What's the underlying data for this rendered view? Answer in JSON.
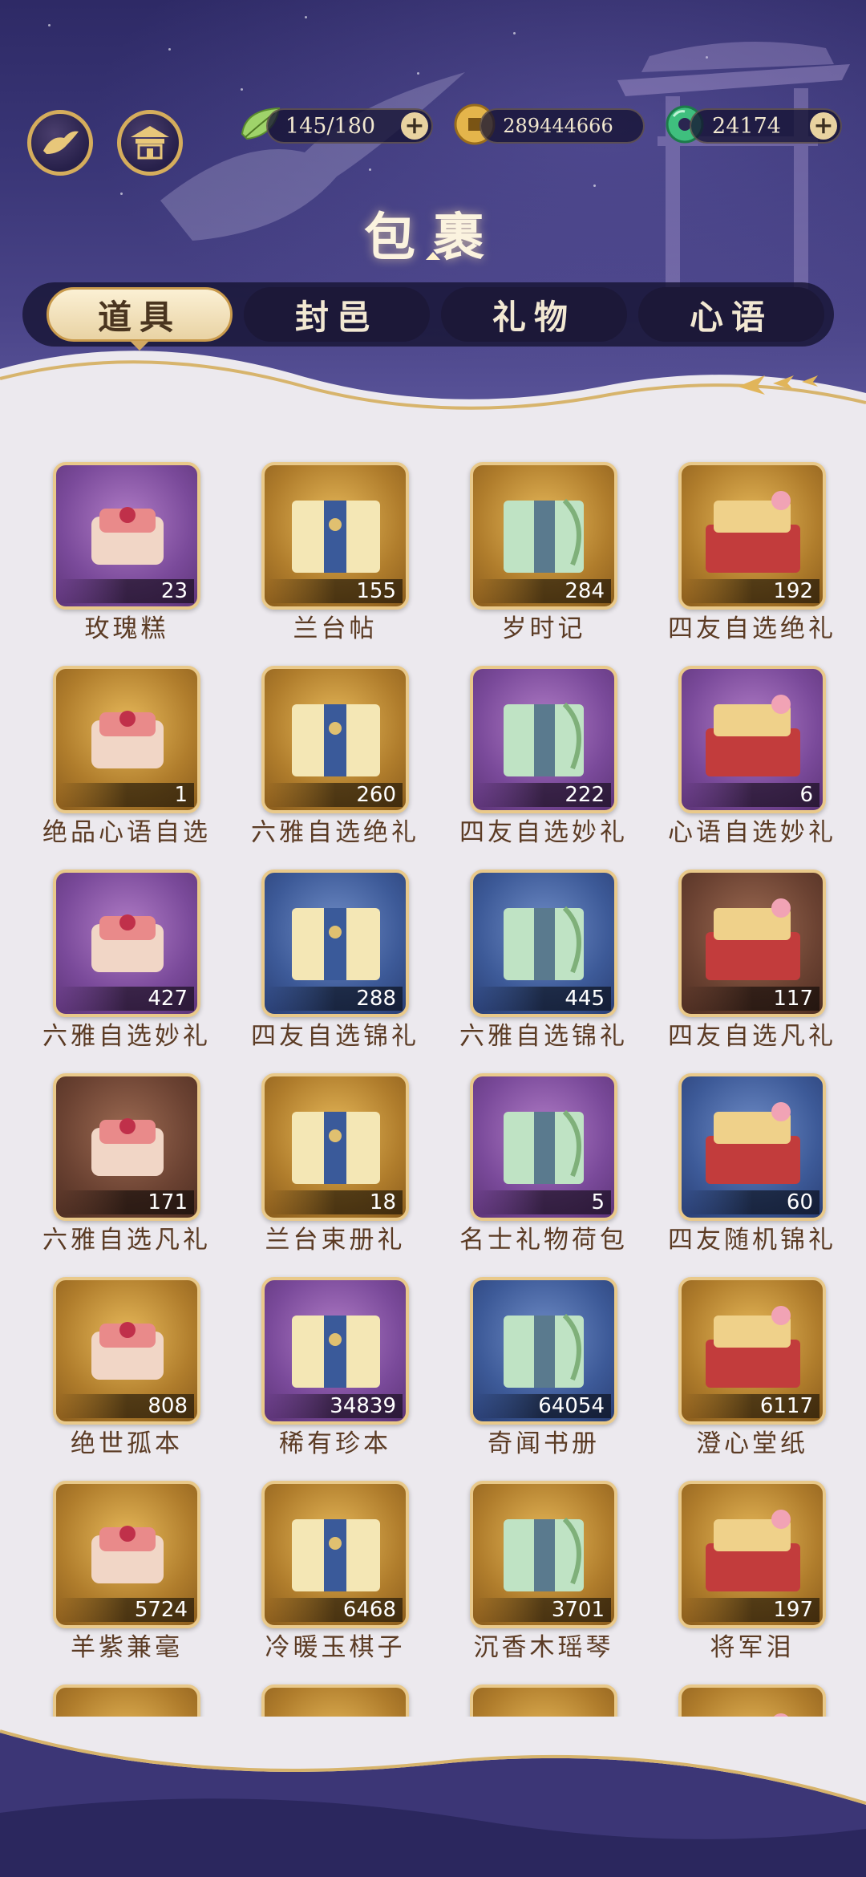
{
  "header": {
    "title": "包裹",
    "stamina": "145/180",
    "coins": "289444666",
    "jade": "24174",
    "plus": "+"
  },
  "tabs": [
    "道具",
    "封邑",
    "礼物",
    "心语"
  ],
  "active_tab": 0,
  "items": [
    {
      "name": "玫瑰糕",
      "count": "23",
      "frame": "purple"
    },
    {
      "name": "兰台帖",
      "count": "155",
      "frame": "gold"
    },
    {
      "name": "岁时记",
      "count": "284",
      "frame": "gold"
    },
    {
      "name": "四友自选绝礼",
      "count": "192",
      "frame": "gold"
    },
    {
      "name": "绝品心语自选",
      "count": "1",
      "frame": "gold"
    },
    {
      "name": "六雅自选绝礼",
      "count": "260",
      "frame": "gold"
    },
    {
      "name": "四友自选妙礼",
      "count": "222",
      "frame": "purple"
    },
    {
      "name": "心语自选妙礼",
      "count": "6",
      "frame": "purple"
    },
    {
      "name": "六雅自选妙礼",
      "count": "427",
      "frame": "purple"
    },
    {
      "name": "四友自选锦礼",
      "count": "288",
      "frame": "blue"
    },
    {
      "name": "六雅自选锦礼",
      "count": "445",
      "frame": "blue"
    },
    {
      "name": "四友自选凡礼",
      "count": "117",
      "frame": "brown"
    },
    {
      "name": "六雅自选凡礼",
      "count": "171",
      "frame": "brown"
    },
    {
      "name": "兰台束册礼",
      "count": "18",
      "frame": "gold"
    },
    {
      "name": "名士礼物荷包",
      "count": "5",
      "frame": "purple"
    },
    {
      "name": "四友随机锦礼",
      "count": "60",
      "frame": "blue"
    },
    {
      "name": "绝世孤本",
      "count": "808",
      "frame": "gold"
    },
    {
      "name": "稀有珍本",
      "count": "34839",
      "frame": "purple"
    },
    {
      "name": "奇闻书册",
      "count": "64054",
      "frame": "blue"
    },
    {
      "name": "澄心堂纸",
      "count": "6117",
      "frame": "gold"
    },
    {
      "name": "羊紫兼毫",
      "count": "5724",
      "frame": "gold"
    },
    {
      "name": "冷暖玉棋子",
      "count": "6468",
      "frame": "gold"
    },
    {
      "name": "沉香木瑶琴",
      "count": "3701",
      "frame": "gold"
    },
    {
      "name": "将军泪",
      "count": "197",
      "frame": "gold"
    },
    {
      "name": "",
      "count": "",
      "frame": "gold"
    },
    {
      "name": "",
      "count": "",
      "frame": "gold"
    },
    {
      "name": "",
      "count": "",
      "frame": "gold"
    },
    {
      "name": "",
      "count": "",
      "frame": "gold"
    }
  ]
}
